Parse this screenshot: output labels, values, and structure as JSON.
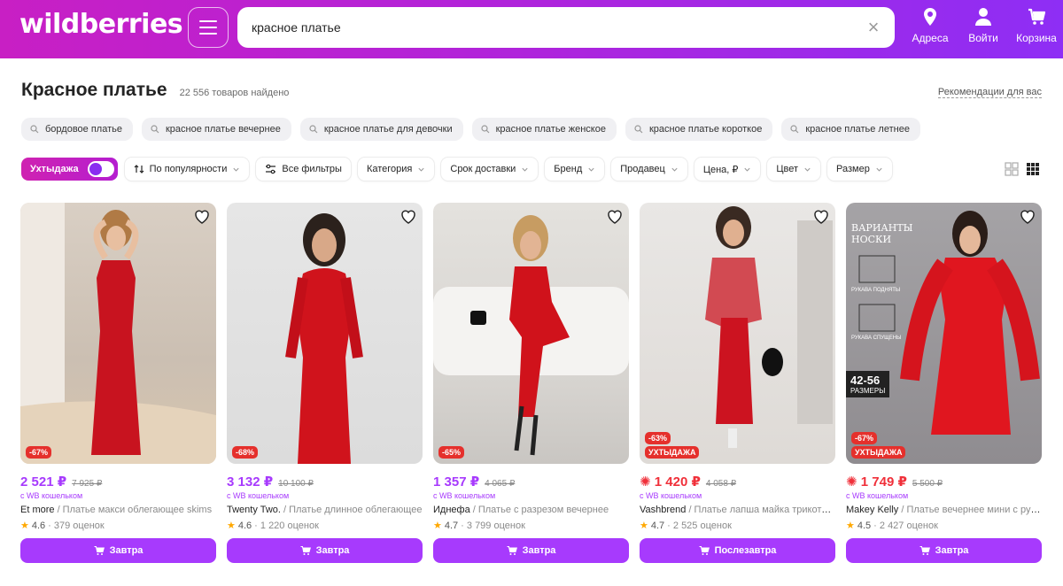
{
  "header": {
    "logo": "wildberries",
    "search_value": "красное платье",
    "actions": [
      {
        "label": "Адреса",
        "icon": "location-pin-icon"
      },
      {
        "label": "Войти",
        "icon": "user-icon"
      },
      {
        "label": "Корзина",
        "icon": "cart-icon"
      }
    ]
  },
  "page": {
    "title": "Красное платье",
    "count": "22 556 товаров найдено",
    "recommend_link": "Рекомендации для вас"
  },
  "suggestions": [
    "бордовое платье",
    "красное платье вечернее",
    "красное платье для девочки",
    "красное платье женское",
    "красное платье короткое",
    "красное платье летнее"
  ],
  "filters": {
    "toggle_label": "Ухтыдажа",
    "sort_label": "По популярности",
    "all_filters": "Все фильтры",
    "dropdowns": [
      "Категория",
      "Срок доставки",
      "Бренд",
      "Продавец",
      "Цена, ₽",
      "Цвет",
      "Размер"
    ]
  },
  "products": [
    {
      "price": "2 521 ₽",
      "old_price": "7 925 ₽",
      "wallet": "с WB кошельком",
      "brand": "Et more",
      "desc": " / Платье макси облегающее skims",
      "rating": "4.6",
      "reviews": "· 379 оценок",
      "discount": "-67%",
      "uxt": "",
      "delivery": "Завтра",
      "price_red": false
    },
    {
      "price": "3 132 ₽",
      "old_price": "10 100 ₽",
      "wallet": "с WB кошельком",
      "brand": "Twenty Two.",
      "desc": " / Платье длинное облегающее",
      "rating": "4.6",
      "reviews": "· 1 220 оценок",
      "discount": "-68%",
      "uxt": "",
      "delivery": "Завтра",
      "price_red": false
    },
    {
      "price": "1 357 ₽",
      "old_price": "4 065 ₽",
      "wallet": "с WB кошельком",
      "brand": "Иднефа",
      "desc": " / Платье с разрезом вечернее",
      "rating": "4.7",
      "reviews": "· 3 799 оценок",
      "discount": "-65%",
      "uxt": "",
      "delivery": "Завтра",
      "price_red": false
    },
    {
      "price": "1 420 ₽",
      "old_price": "4 058 ₽",
      "wallet": "с WB кошельком",
      "brand": "Vashbrend",
      "desc": " / Платье лапша майка трикотажное",
      "rating": "4.7",
      "reviews": "· 2 525 оценок",
      "discount": "-63%",
      "uxt": "УХТЫДАЖА",
      "delivery": "Послезавтра",
      "price_red": true
    },
    {
      "price": "1 749 ₽",
      "old_price": "5 500 ₽",
      "wallet": "с WB кошельком",
      "brand": "Makey Kelly",
      "desc": " / Платье вечернее мини с рукавами",
      "rating": "4.5",
      "reviews": "· 2 427 оценок",
      "discount": "-67%",
      "uxt": "УХТЫДАЖА",
      "delivery": "Завтра",
      "price_red": true
    }
  ],
  "product5_overlay": {
    "title": "ВАРИАНТЫ НОСКИ",
    "sleeve_up": "РУКАВА ПОДНЯТЫ",
    "sleeve_down": "РУКАВА СПУЩЕНЫ",
    "sizes_num": "42-56",
    "sizes_label": "РАЗМЕРЫ"
  },
  "colors": {
    "accent": "#a73afd",
    "red": "#f0303a",
    "header_from": "#c81fc4",
    "header_to": "#8e2ef5"
  }
}
